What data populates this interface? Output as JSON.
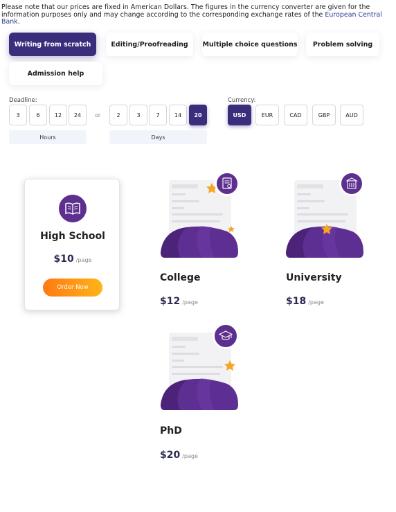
{
  "notice": {
    "text": "Please note that our prices are fixed in American Dollars. The figures in the currency converter are given for the information purposes only and may change according to the corresponding exchange rates of the ",
    "link": "European Central Bank",
    "end": "."
  },
  "service_tabs": [
    {
      "label": "Writing from scratch",
      "active": true
    },
    {
      "label": "Editing/Proofreading",
      "active": false
    },
    {
      "label": "Multiple choice questions",
      "active": false
    },
    {
      "label": "Problem solving",
      "active": false
    },
    {
      "label": "Admission help",
      "active": false
    }
  ],
  "deadline": {
    "label": "Deadline:",
    "hours": [
      "3",
      "6",
      "12",
      "24"
    ],
    "or": "or",
    "days": [
      "2",
      "3",
      "7",
      "14",
      "20"
    ],
    "selected_day": "20",
    "hours_label": "Hours",
    "days_label": "Days"
  },
  "currency": {
    "label": "Currency:",
    "options": [
      "USD",
      "EUR",
      "CAD",
      "GBP",
      "AUD"
    ],
    "selected": "USD"
  },
  "levels": {
    "high_school": {
      "title": "High School",
      "price": "$10",
      "unit": "/page",
      "button": "Order Now"
    },
    "college": {
      "title": "College",
      "price": "$12",
      "unit": "/page"
    },
    "university": {
      "title": "University",
      "price": "$18",
      "unit": "/page"
    },
    "phd": {
      "title": "PhD",
      "price": "$20",
      "unit": "/page"
    }
  },
  "colors": {
    "primary": "#3a2d7c",
    "accent_purple": "#5d2f8e",
    "orange_start": "#ff7a10",
    "orange_end": "#ffb41a",
    "star": "#f5a623"
  },
  "icons": {
    "high_school": "book-icon",
    "college": "certificate-icon",
    "university": "building-icon",
    "phd": "graduation-cap-icon"
  }
}
